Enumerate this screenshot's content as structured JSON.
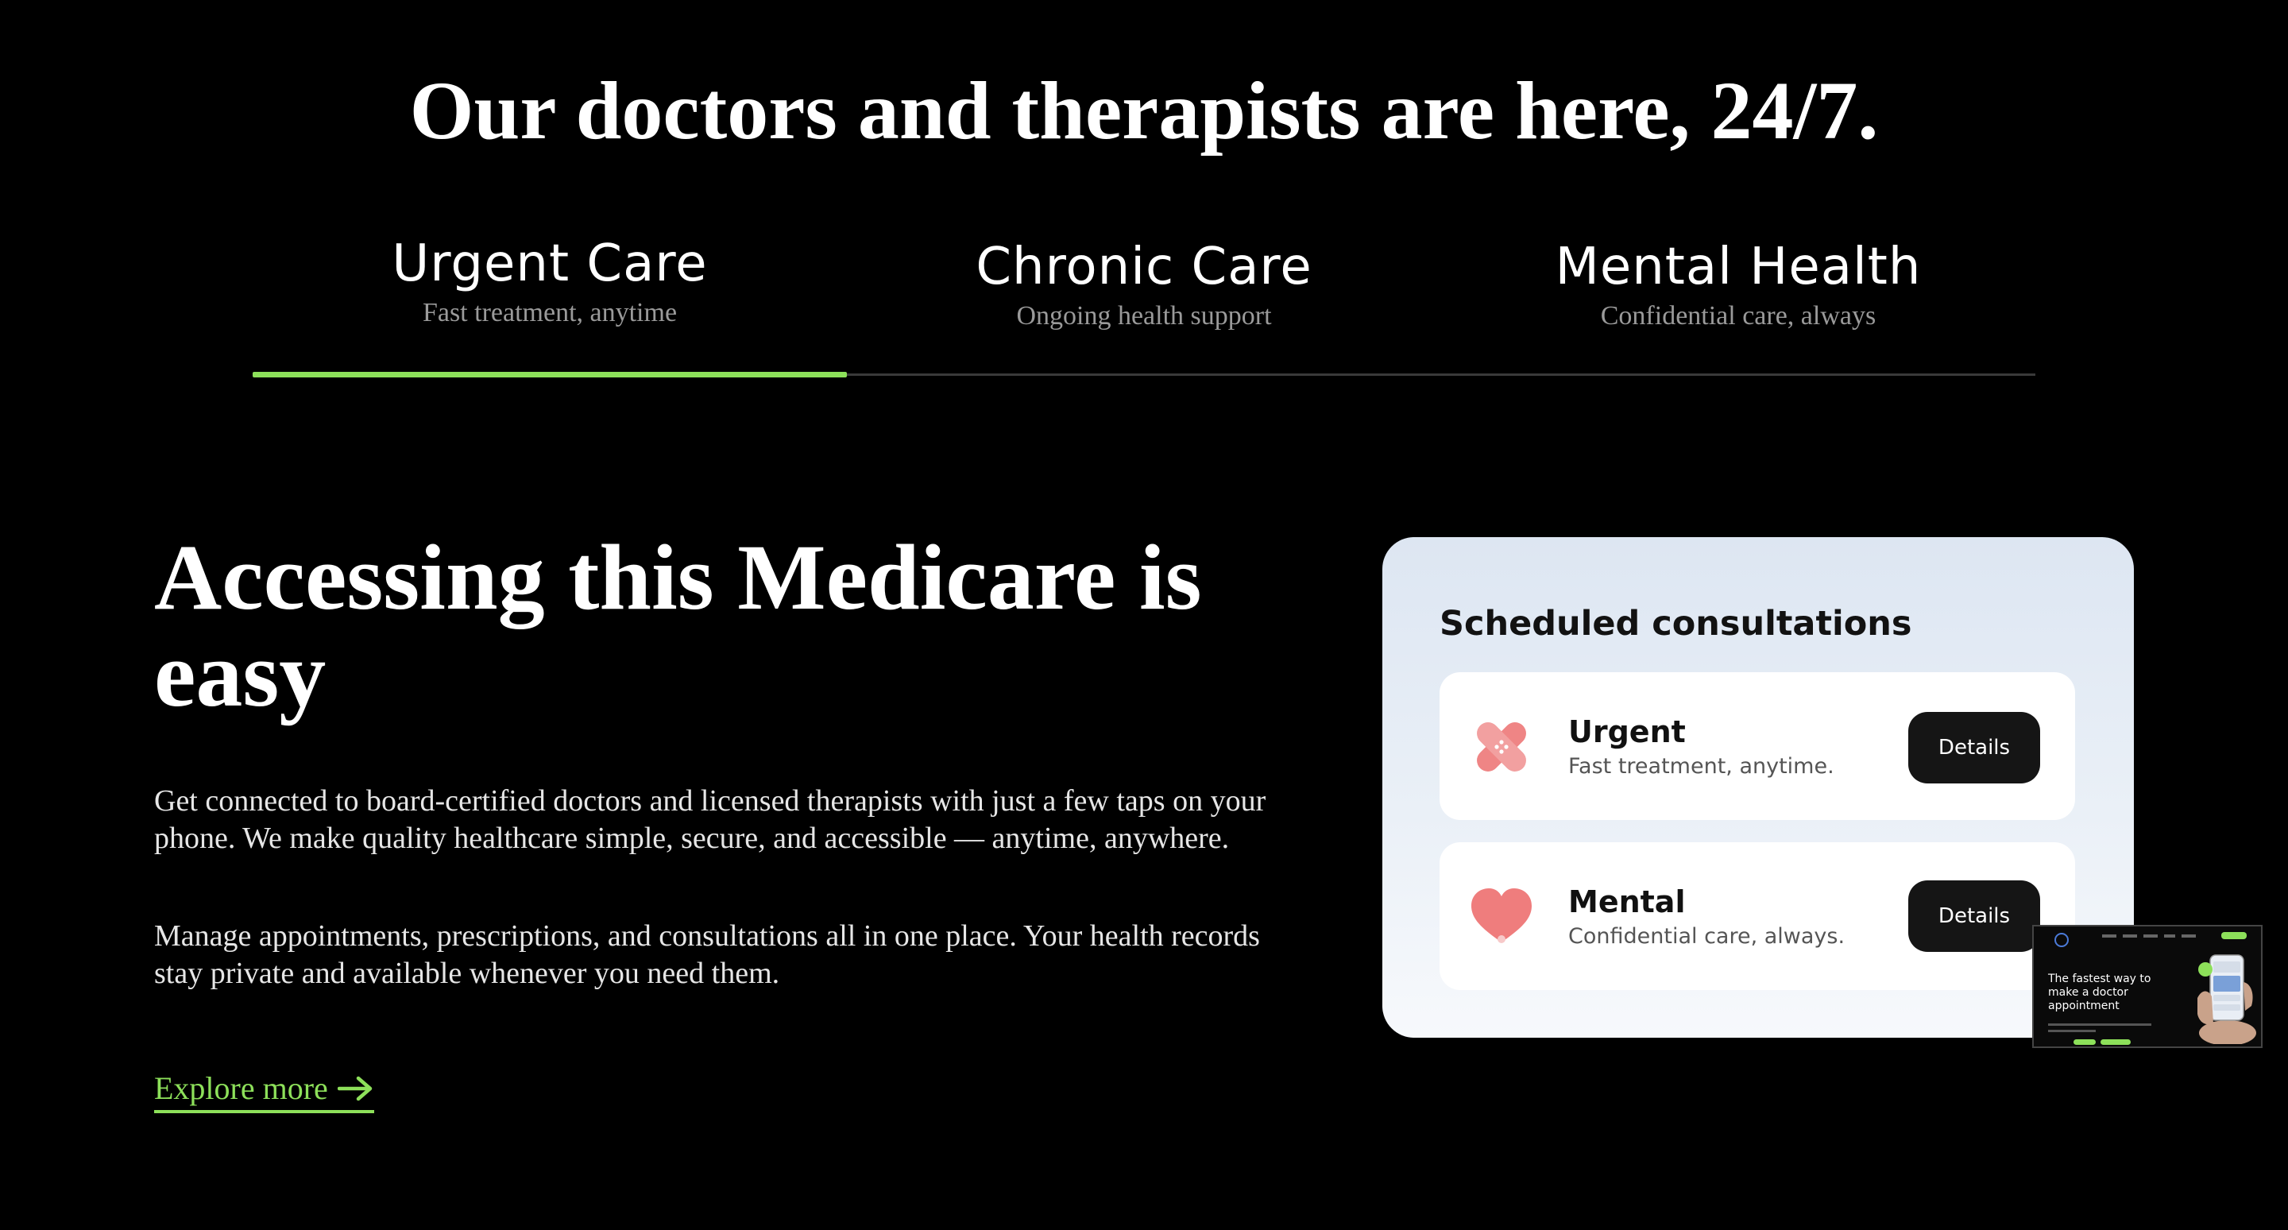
{
  "headline": "Our doctors and therapists are here, 24/7.",
  "tabs": [
    {
      "title": "Urgent Care",
      "subtitle": "Fast treatment, anytime",
      "active": true
    },
    {
      "title": "Chronic Care",
      "subtitle": "Ongoing health support",
      "active": false
    },
    {
      "title": "Mental Health",
      "subtitle": "Confidential care, always",
      "active": false
    }
  ],
  "main": {
    "title": "Accessing this Medicare is easy",
    "paragraph1": "Get connected to board-certified doctors and licensed therapists with just a few taps on your phone. We make quality healthcare simple, secure, and accessible — anytime, anywhere.",
    "paragraph2": "Manage appointments, prescriptions, and consultations all in one place. Your health records stay private and available whenever you need them.",
    "explore_label": "Explore more"
  },
  "card": {
    "title": "Scheduled consultations",
    "items": [
      {
        "name": "Urgent",
        "subtitle": "Fast treatment, anytime.",
        "button": "Details",
        "icon": "bandage-icon"
      },
      {
        "name": "Mental",
        "subtitle": "Confidential care, always.",
        "button": "Details",
        "icon": "heart-icon"
      }
    ]
  },
  "thumbnail": {
    "text": "The fastest way to make a doctor appointment"
  },
  "colors": {
    "background": "#000000",
    "accent": "#8de05a",
    "card_bg": "#e3eaf4",
    "icon": "#ef7d7d",
    "button": "#151515"
  }
}
